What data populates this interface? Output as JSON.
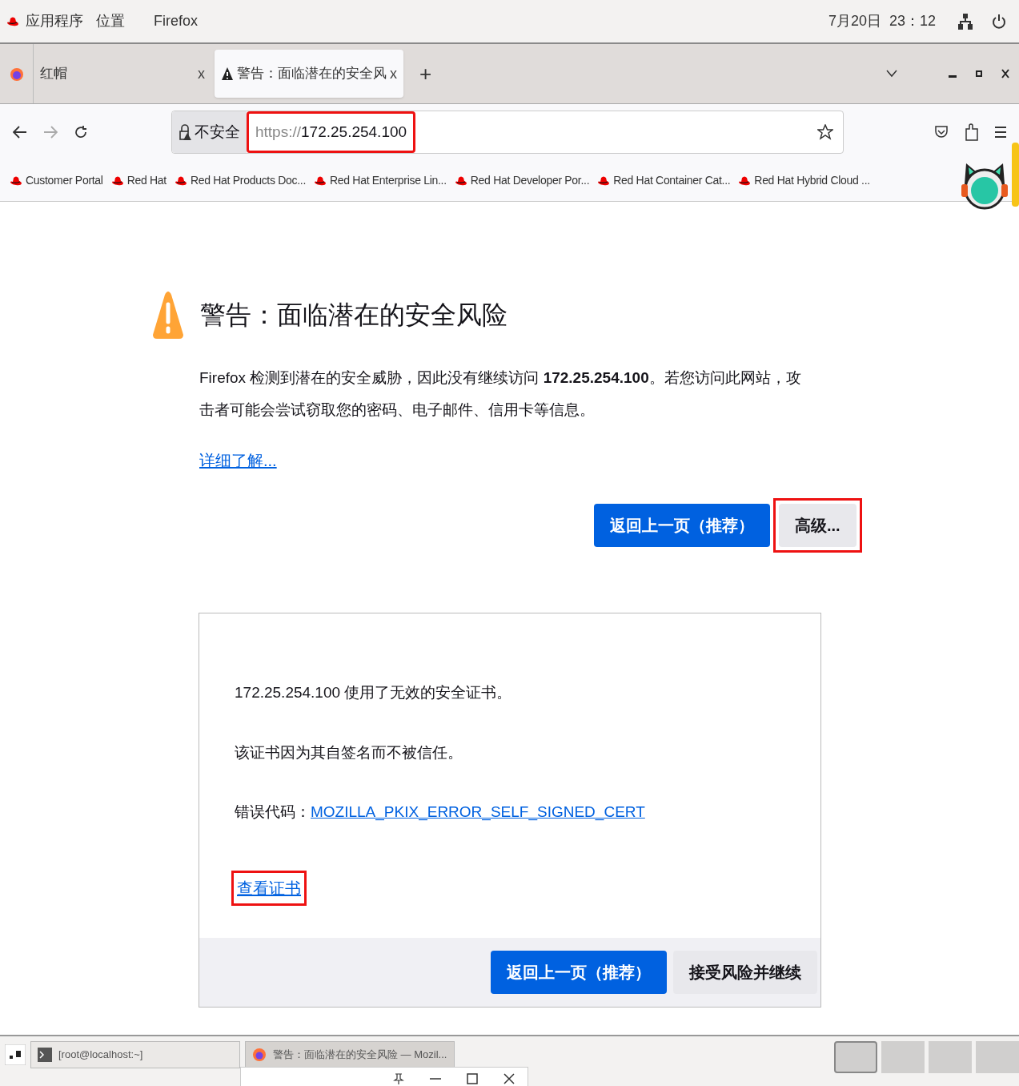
{
  "top_bar": {
    "menus": [
      "应用程序",
      "位置",
      "Firefox"
    ],
    "clock": "7月20日  23：12"
  },
  "tabs": [
    {
      "label": "红帽",
      "close": "x",
      "selected": false,
      "kind": "normal"
    },
    {
      "label": "警告：面临潜在的安全风",
      "close": "x",
      "selected": true,
      "kind": "warning"
    }
  ],
  "new_tab": "+",
  "address_bar": {
    "security": "不安全",
    "url_scheme": "https://",
    "url_host": "172.25.254.100",
    "highlighted": true
  },
  "bookmarks": [
    "Customer Portal",
    "Red Hat",
    "Red Hat Products Doc...",
    "Red Hat Enterprise Lin...",
    "Red Hat Developer Por...",
    "Red Hat Container Cat...",
    "Red Hat Hybrid Cloud ..."
  ],
  "page": {
    "title": "警告：面临潜在的安全风险",
    "description": "Firefox 检测到潜在的安全威胁，因此没有继续访问 **172.25.254.100**。若您访问此网站，攻击者可能会尝试窃取您的密码、电子邮件、信用卡等信息。",
    "learn_more": "详细了解...",
    "buttons": [
      {
        "label": "返回上一页（推荐）",
        "kind": "primary",
        "highlighted": false
      },
      {
        "label": "高级...",
        "kind": "secondary",
        "highlighted": true
      }
    ],
    "advanced": {
      "lines": [
        "172.25.254.100 使用了无效的安全证书。",
        "该证书因为其自签名而不被信任。"
      ],
      "error_label": "错误代码：",
      "error_code": "MOZILLA_PKIX_ERROR_SELF_SIGNED_CERT",
      "view_cert": {
        "label": "查看证书",
        "highlighted": true
      },
      "buttons": [
        {
          "label": "返回上一页（推荐）",
          "kind": "primary"
        },
        {
          "label": "接受风险并继续",
          "kind": "secondary"
        }
      ]
    }
  },
  "taskbar": {
    "windows": [
      {
        "label": "[root@localhost:~]",
        "selected": false,
        "kind": "terminal"
      },
      {
        "label": "警告：面临潜在的安全风险 — Mozil...",
        "selected": true,
        "kind": "browser"
      }
    ],
    "workspaces": [
      {
        "selected": true
      },
      {
        "selected": false
      },
      {
        "selected": false
      },
      {
        "selected": false
      }
    ]
  }
}
